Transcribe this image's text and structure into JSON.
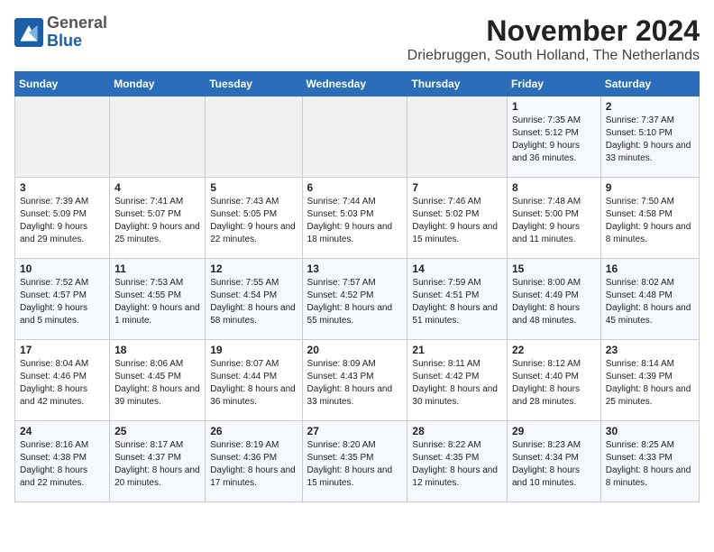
{
  "logo": {
    "general": "General",
    "blue": "Blue"
  },
  "title": "November 2024",
  "subtitle": "Driebruggen, South Holland, The Netherlands",
  "header_days": [
    "Sunday",
    "Monday",
    "Tuesday",
    "Wednesday",
    "Thursday",
    "Friday",
    "Saturday"
  ],
  "weeks": [
    [
      {
        "day": "",
        "info": ""
      },
      {
        "day": "",
        "info": ""
      },
      {
        "day": "",
        "info": ""
      },
      {
        "day": "",
        "info": ""
      },
      {
        "day": "",
        "info": ""
      },
      {
        "day": "1",
        "info": "Sunrise: 7:35 AM\nSunset: 5:12 PM\nDaylight: 9 hours and 36 minutes."
      },
      {
        "day": "2",
        "info": "Sunrise: 7:37 AM\nSunset: 5:10 PM\nDaylight: 9 hours and 33 minutes."
      }
    ],
    [
      {
        "day": "3",
        "info": "Sunrise: 7:39 AM\nSunset: 5:09 PM\nDaylight: 9 hours and 29 minutes."
      },
      {
        "day": "4",
        "info": "Sunrise: 7:41 AM\nSunset: 5:07 PM\nDaylight: 9 hours and 25 minutes."
      },
      {
        "day": "5",
        "info": "Sunrise: 7:43 AM\nSunset: 5:05 PM\nDaylight: 9 hours and 22 minutes."
      },
      {
        "day": "6",
        "info": "Sunrise: 7:44 AM\nSunset: 5:03 PM\nDaylight: 9 hours and 18 minutes."
      },
      {
        "day": "7",
        "info": "Sunrise: 7:46 AM\nSunset: 5:02 PM\nDaylight: 9 hours and 15 minutes."
      },
      {
        "day": "8",
        "info": "Sunrise: 7:48 AM\nSunset: 5:00 PM\nDaylight: 9 hours and 11 minutes."
      },
      {
        "day": "9",
        "info": "Sunrise: 7:50 AM\nSunset: 4:58 PM\nDaylight: 9 hours and 8 minutes."
      }
    ],
    [
      {
        "day": "10",
        "info": "Sunrise: 7:52 AM\nSunset: 4:57 PM\nDaylight: 9 hours and 5 minutes."
      },
      {
        "day": "11",
        "info": "Sunrise: 7:53 AM\nSunset: 4:55 PM\nDaylight: 9 hours and 1 minute."
      },
      {
        "day": "12",
        "info": "Sunrise: 7:55 AM\nSunset: 4:54 PM\nDaylight: 8 hours and 58 minutes."
      },
      {
        "day": "13",
        "info": "Sunrise: 7:57 AM\nSunset: 4:52 PM\nDaylight: 8 hours and 55 minutes."
      },
      {
        "day": "14",
        "info": "Sunrise: 7:59 AM\nSunset: 4:51 PM\nDaylight: 8 hours and 51 minutes."
      },
      {
        "day": "15",
        "info": "Sunrise: 8:00 AM\nSunset: 4:49 PM\nDaylight: 8 hours and 48 minutes."
      },
      {
        "day": "16",
        "info": "Sunrise: 8:02 AM\nSunset: 4:48 PM\nDaylight: 8 hours and 45 minutes."
      }
    ],
    [
      {
        "day": "17",
        "info": "Sunrise: 8:04 AM\nSunset: 4:46 PM\nDaylight: 8 hours and 42 minutes."
      },
      {
        "day": "18",
        "info": "Sunrise: 8:06 AM\nSunset: 4:45 PM\nDaylight: 8 hours and 39 minutes."
      },
      {
        "day": "19",
        "info": "Sunrise: 8:07 AM\nSunset: 4:44 PM\nDaylight: 8 hours and 36 minutes."
      },
      {
        "day": "20",
        "info": "Sunrise: 8:09 AM\nSunset: 4:43 PM\nDaylight: 8 hours and 33 minutes."
      },
      {
        "day": "21",
        "info": "Sunrise: 8:11 AM\nSunset: 4:42 PM\nDaylight: 8 hours and 30 minutes."
      },
      {
        "day": "22",
        "info": "Sunrise: 8:12 AM\nSunset: 4:40 PM\nDaylight: 8 hours and 28 minutes."
      },
      {
        "day": "23",
        "info": "Sunrise: 8:14 AM\nSunset: 4:39 PM\nDaylight: 8 hours and 25 minutes."
      }
    ],
    [
      {
        "day": "24",
        "info": "Sunrise: 8:16 AM\nSunset: 4:38 PM\nDaylight: 8 hours and 22 minutes."
      },
      {
        "day": "25",
        "info": "Sunrise: 8:17 AM\nSunset: 4:37 PM\nDaylight: 8 hours and 20 minutes."
      },
      {
        "day": "26",
        "info": "Sunrise: 8:19 AM\nSunset: 4:36 PM\nDaylight: 8 hours and 17 minutes."
      },
      {
        "day": "27",
        "info": "Sunrise: 8:20 AM\nSunset: 4:35 PM\nDaylight: 8 hours and 15 minutes."
      },
      {
        "day": "28",
        "info": "Sunrise: 8:22 AM\nSunset: 4:35 PM\nDaylight: 8 hours and 12 minutes."
      },
      {
        "day": "29",
        "info": "Sunrise: 8:23 AM\nSunset: 4:34 PM\nDaylight: 8 hours and 10 minutes."
      },
      {
        "day": "30",
        "info": "Sunrise: 8:25 AM\nSunset: 4:33 PM\nDaylight: 8 hours and 8 minutes."
      }
    ]
  ]
}
